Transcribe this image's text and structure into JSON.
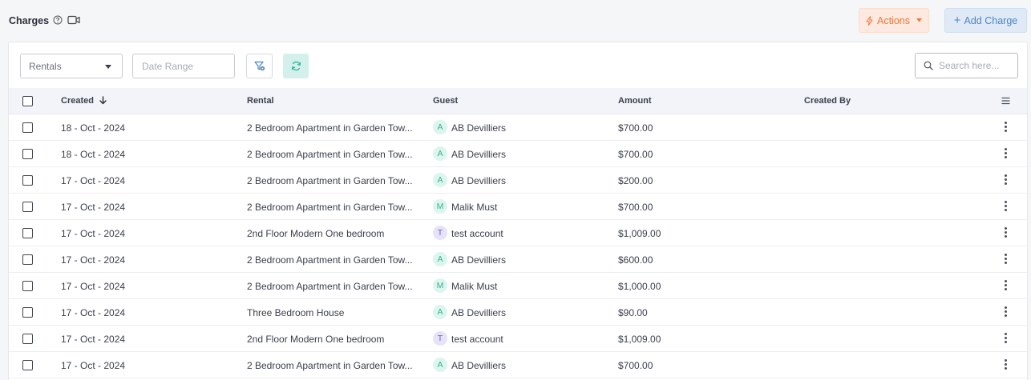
{
  "header": {
    "title": "Charges",
    "help_icon": "help-circle-icon",
    "video_icon": "video-camera-icon",
    "actions_label": "Actions",
    "add_charge_label": "Add Charge",
    "colors": {
      "actions_text": "#f0763b",
      "actions_bg": "#fde9df",
      "add_text": "#4b86c9",
      "add_bg": "#dfeaf6"
    }
  },
  "filters": {
    "rentals_select": "Rentals",
    "date_range_placeholder": "Date Range",
    "filter_icon": "filter-settings-icon",
    "refresh_icon": "refresh-icon",
    "search_placeholder": "Search here...",
    "refresh_color": "#2bb59a"
  },
  "table": {
    "columns": {
      "created": "Created",
      "rental": "Rental",
      "guest": "Guest",
      "amount": "Amount",
      "created_by": "Created By"
    },
    "sort_icon": "arrow-down-icon",
    "column_menu_icon": "menu-lines-icon",
    "avatar_colors": {
      "A": {
        "bg": "#dcf5ee",
        "fg": "#37b38f"
      },
      "M": {
        "bg": "#dcf5ee",
        "fg": "#37b38f"
      },
      "T": {
        "bg": "#e6e3f8",
        "fg": "#6a5fc4"
      }
    },
    "rows": [
      {
        "created": "18 - Oct - 2024",
        "rental": "2 Bedroom Apartment in Garden Tow...",
        "guest_initial": "A",
        "guest": "AB Devilliers",
        "amount": "$700.00",
        "created_by": ""
      },
      {
        "created": "18 - Oct - 2024",
        "rental": "2 Bedroom Apartment in Garden Tow...",
        "guest_initial": "A",
        "guest": "AB Devilliers",
        "amount": "$700.00",
        "created_by": ""
      },
      {
        "created": "17 - Oct - 2024",
        "rental": "2 Bedroom Apartment in Garden Tow...",
        "guest_initial": "A",
        "guest": "AB Devilliers",
        "amount": "$200.00",
        "created_by": ""
      },
      {
        "created": "17 - Oct - 2024",
        "rental": "2 Bedroom Apartment in Garden Tow...",
        "guest_initial": "M",
        "guest": "Malik Must",
        "amount": "$700.00",
        "created_by": ""
      },
      {
        "created": "17 - Oct - 2024",
        "rental": "2nd Floor Modern One bedroom",
        "guest_initial": "T",
        "guest": "test account",
        "amount": "$1,009.00",
        "created_by": ""
      },
      {
        "created": "17 - Oct - 2024",
        "rental": "2 Bedroom Apartment in Garden Tow...",
        "guest_initial": "A",
        "guest": "AB Devilliers",
        "amount": "$600.00",
        "created_by": ""
      },
      {
        "created": "17 - Oct - 2024",
        "rental": "2 Bedroom Apartment in Garden Tow...",
        "guest_initial": "M",
        "guest": "Malik Must",
        "amount": "$1,000.00",
        "created_by": ""
      },
      {
        "created": "17 - Oct - 2024",
        "rental": "Three Bedroom House",
        "guest_initial": "A",
        "guest": "AB Devilliers",
        "amount": "$90.00",
        "created_by": ""
      },
      {
        "created": "17 - Oct - 2024",
        "rental": "2nd Floor Modern One bedroom",
        "guest_initial": "T",
        "guest": "test account",
        "amount": "$1,009.00",
        "created_by": ""
      },
      {
        "created": "17 - Oct - 2024",
        "rental": "2 Bedroom Apartment in Garden Tow...",
        "guest_initial": "A",
        "guest": "AB Devilliers",
        "amount": "$700.00",
        "created_by": ""
      }
    ]
  }
}
